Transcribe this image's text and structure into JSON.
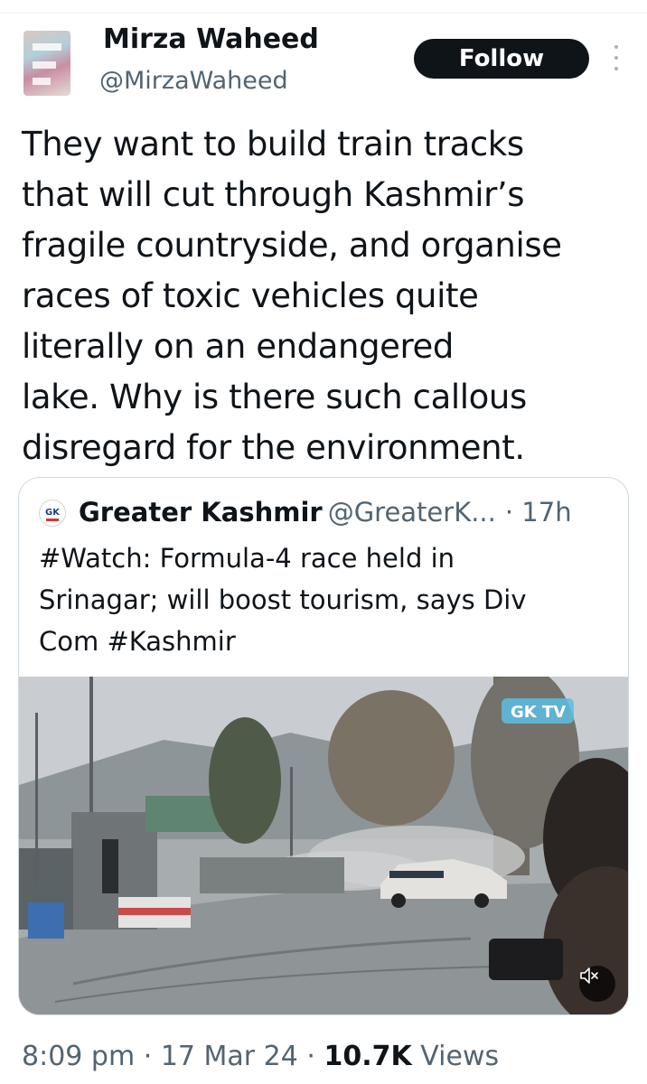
{
  "author": {
    "name": "Mirza Waheed",
    "handle": "@MirzaWaheed",
    "follow_label": "Follow"
  },
  "tweet": {
    "lines": [
      "They want to build train tracks",
      "that will cut through Kashmir’s",
      "fragile countryside, and organise",
      "races of toxic vehicles quite",
      "literally on an endangered",
      "lake. Why is there such callous",
      "disregard for the environment."
    ]
  },
  "quoted": {
    "name": "Greater Kashmir",
    "handle": "@GreaterK...",
    "time": "· 17h",
    "avatar_text": "GK",
    "lines": [
      "#Watch: Formula-4 race held in",
      "Srinagar; will boost tourism, says Div",
      "Com #Kashmir"
    ],
    "video": {
      "watermark": "GK TV",
      "muted": true
    }
  },
  "meta": {
    "time": "8:09 pm",
    "date": "17 Mar 24",
    "views_count": "10.7K",
    "views_label": "Views"
  },
  "colors": {
    "text": "#0f1419",
    "secondary": "#536471",
    "border": "#cfd9de",
    "follow_bg": "#0f1419"
  }
}
